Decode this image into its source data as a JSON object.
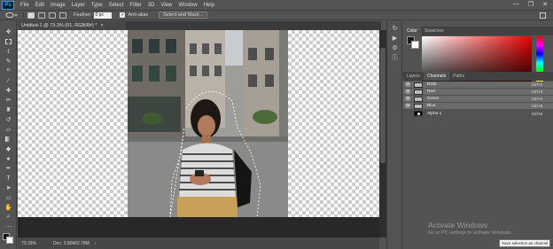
{
  "app": {
    "logo_text": "Ps"
  },
  "menu": [
    "File",
    "Edit",
    "Image",
    "Layer",
    "Type",
    "Select",
    "Filter",
    "3D",
    "View",
    "Window",
    "Help"
  ],
  "window_controls": {
    "minimize": "—",
    "restore": "❐",
    "close": "✕"
  },
  "options_bar": {
    "feather_label": "Feather:",
    "feather_value": "0 px",
    "antialias_label": "Anti-alias",
    "antialias_checked": true,
    "select_mask_label": "Select and Mask..."
  },
  "document_tab": {
    "title": "Untitled-1 @ 73.3% (01, RGB/8#) *",
    "close": "×"
  },
  "status_bar": {
    "zoom": "73.33%",
    "doc_info": "Doc: 3.80M/2.78M",
    "arrow": "›"
  },
  "tools": [
    "move-tool-icon",
    "marquee-tool-icon",
    "lasso-tool-icon",
    "quick-select-tool-icon",
    "crop-tool-icon",
    "eyedropper-tool-icon",
    "healing-tool-icon",
    "brush-tool-icon",
    "stamp-tool-icon",
    "history-brush-icon",
    "eraser-tool-icon",
    "gradient-tool-icon",
    "blur-tool-icon",
    "dodge-tool-icon",
    "pen-tool-icon",
    "type-tool-icon",
    "path-select-icon",
    "rectangle-tool-icon",
    "hand-tool-icon",
    "zoom-tool-icon",
    "edit-toolbar-icon"
  ],
  "color_panel": {
    "tabs": [
      "Color",
      "Swatches"
    ],
    "active_tab": "Color",
    "fg_color": "#1a1a1a",
    "bg_color": "#ffffff"
  },
  "channels_panel": {
    "tabs": [
      "Layers",
      "Channels",
      "Paths"
    ],
    "active_tab": "Channels",
    "rows": [
      {
        "name": "RGB",
        "shortcut": "Ctrl+2",
        "visible": true
      },
      {
        "name": "Red",
        "shortcut": "Ctrl+3",
        "visible": true
      },
      {
        "name": "Green",
        "shortcut": "Ctrl+4",
        "visible": true
      },
      {
        "name": "Blue",
        "shortcut": "Ctrl+5",
        "visible": true
      },
      {
        "name": "Alpha 1",
        "shortcut": "Ctrl+6",
        "visible": false
      }
    ]
  },
  "watermark": {
    "title": "Activate Windows",
    "subtitle": "Go to PC settings to activate Windows."
  },
  "tooltip": "Save selection as channel"
}
